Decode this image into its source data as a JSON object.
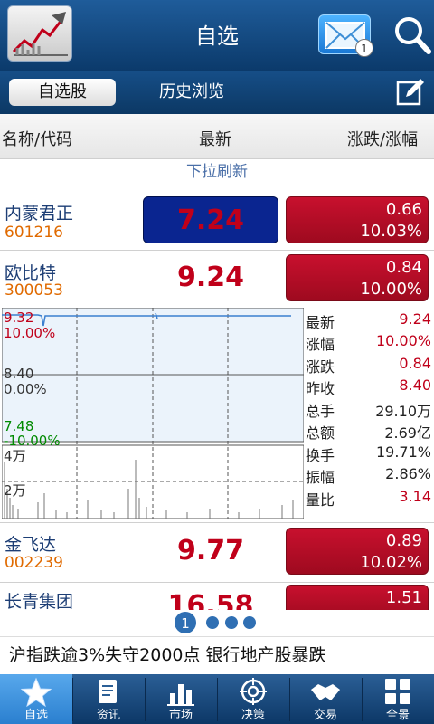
{
  "header": {
    "title": "自选",
    "mail_count": "1"
  },
  "tabs": {
    "active": "自选股",
    "history": "历史浏览"
  },
  "columns": {
    "name": "名称/代码",
    "latest": "最新",
    "change": "涨跌/涨幅"
  },
  "refresh_hint": "下拉刷新",
  "stocks": [
    {
      "name": "内蒙君正",
      "code": "601216",
      "price": "7.24",
      "change": "0.66",
      "pct": "10.03%"
    },
    {
      "name": "欧比特",
      "code": "300053",
      "price": "9.24",
      "change": "0.84",
      "pct": "10.00%"
    },
    {
      "name": "金飞达",
      "code": "002239",
      "price": "9.77",
      "change": "0.89",
      "pct": "10.02%"
    },
    {
      "name": "长青集团",
      "code": "",
      "price": "16.58",
      "change": "1.51",
      "pct": ""
    }
  ],
  "chart": {
    "price_high": "9.32",
    "pct_high": "10.00%",
    "price_mid": "8.40",
    "pct_mid": "0.00%",
    "price_low": "7.48",
    "pct_low": "-10.00%",
    "vol_high": "4万",
    "vol_mid": "2万"
  },
  "stats": [
    {
      "label": "最新",
      "value": "9.24",
      "color": "#c0001a"
    },
    {
      "label": "涨幅",
      "value": "10.00%",
      "color": "#c0001a"
    },
    {
      "label": "涨跌",
      "value": "0.84",
      "color": "#c0001a"
    },
    {
      "label": "昨收",
      "value": "8.40",
      "color": "#c0001a"
    },
    {
      "label": "总手",
      "value": "29.10万",
      "color": "#222222"
    },
    {
      "label": "总额",
      "value": "2.69亿",
      "color": "#222222"
    },
    {
      "label": "换手",
      "value": "19.71%",
      "color": "#222222"
    },
    {
      "label": "振幅",
      "value": "2.86%",
      "color": "#222222"
    },
    {
      "label": "量比",
      "value": "3.14",
      "color": "#c0001a"
    }
  ],
  "pager": {
    "current": "1"
  },
  "news": "沪指跌逾3%失守2000点 银行地产股暴跌",
  "nav": [
    "自选",
    "资讯",
    "市场",
    "决策",
    "交易",
    "全景"
  ],
  "colors": {
    "up": "#c0001a",
    "header": "#0b3a6b",
    "code": "#e06a00"
  }
}
